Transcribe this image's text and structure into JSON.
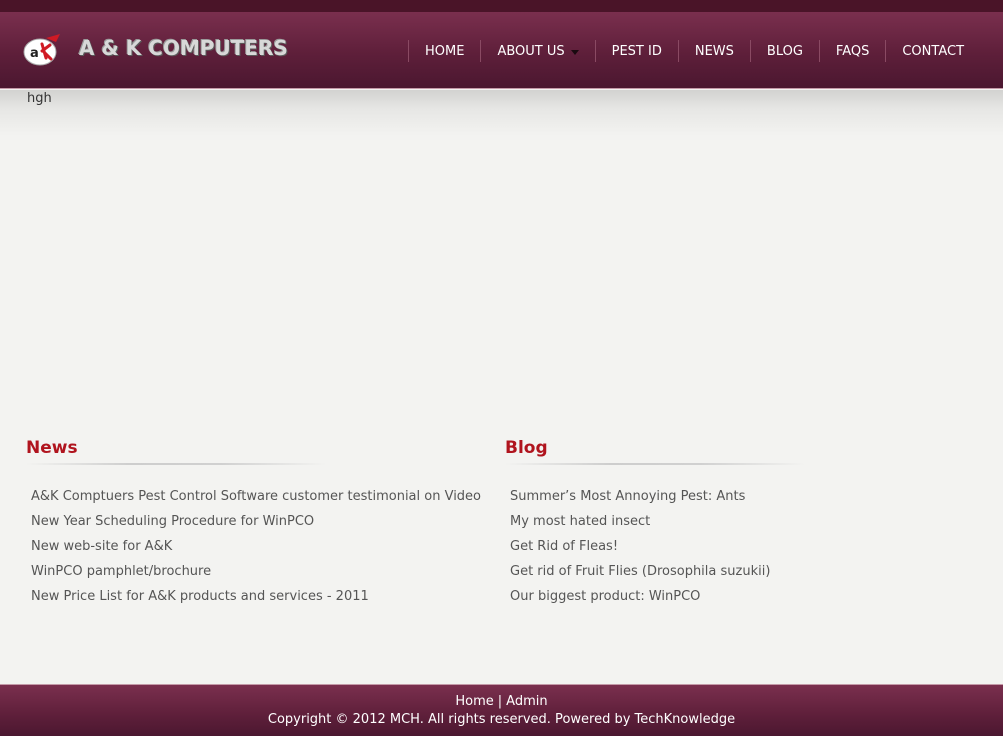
{
  "brand": {
    "name": "A & K COMPUTERS",
    "logo_icon": "ak-logo-icon"
  },
  "nav": {
    "items": [
      {
        "label": "HOME"
      },
      {
        "label": "ABOUT US",
        "has_dropdown": true
      },
      {
        "label": "PEST ID"
      },
      {
        "label": "NEWS"
      },
      {
        "label": "BLOG"
      },
      {
        "label": "FAQS"
      },
      {
        "label": "CONTACT"
      }
    ]
  },
  "content": {
    "text": "hgh"
  },
  "news": {
    "title": "News",
    "items": [
      "A&K Comptuers Pest Control Software customer testimonial on Video",
      "New Year Scheduling Procedure for WinPCO",
      "New web-site for A&K",
      "WinPCO pamphlet/brochure",
      "New Price List for A&K products and services - 2011"
    ]
  },
  "blog": {
    "title": "Blog",
    "items": [
      "Summer’s Most Annoying Pest: Ants",
      "My most hated insect",
      "Get Rid of Fleas!",
      "Get rid of Fruit Flies (Drosophila suzukii)",
      "Our biggest product: WinPCO"
    ]
  },
  "footer": {
    "home": "Home",
    "separator": "|",
    "admin": "Admin",
    "copyright": "Copyright © 2012 MCH. All rights reserved. Powered by TechKnowledge"
  },
  "colors": {
    "header": "#5e1f3a",
    "heading_red": "#b0141e",
    "background": "#f3f3f1"
  }
}
